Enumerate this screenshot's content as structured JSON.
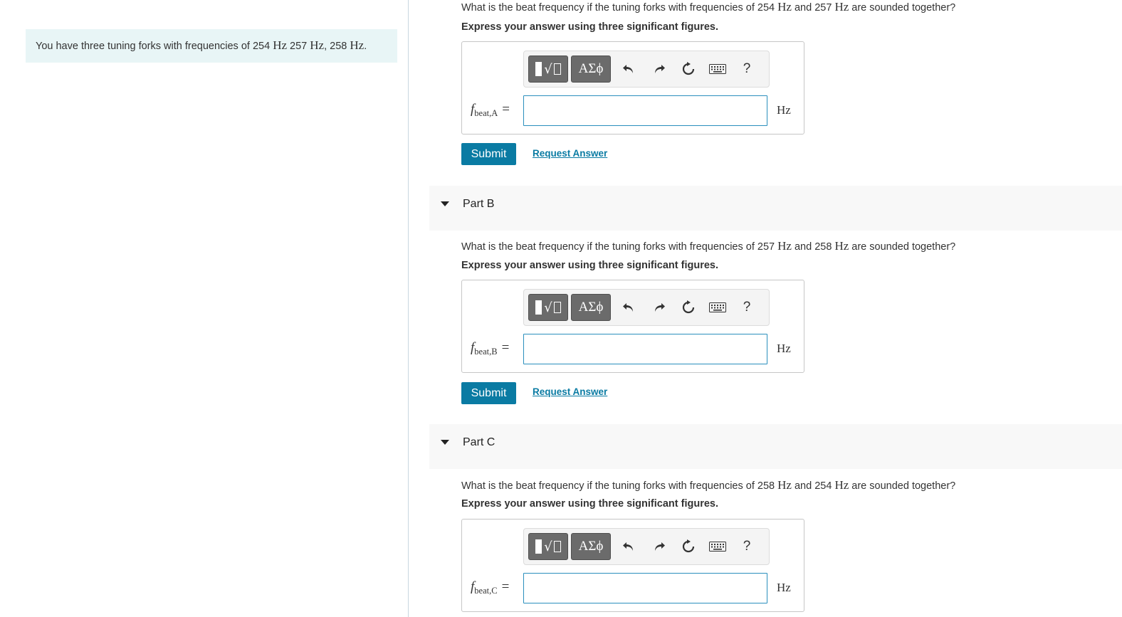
{
  "intro": {
    "text_prefix": "You have three tuning forks with frequencies of 254 ",
    "unit1": "Hz",
    "text_mid1": " 257 ",
    "unit2": "Hz",
    "text_mid2": ", 258 ",
    "unit3": "Hz",
    "text_end": "."
  },
  "toolbar": {
    "greek_label": "ΑΣϕ",
    "help_label": "?"
  },
  "parts": [
    {
      "title": "",
      "question_prefix": "What is the beat frequency if the tuning forks with frequencies of 254 ",
      "question_unit1": "Hz",
      "question_mid": " and 257 ",
      "question_unit2": "Hz",
      "question_suffix": " are sounded together?",
      "instruction": "Express your answer using three significant figures.",
      "var_main": "f",
      "var_sub": "beat,A",
      "equals": "=",
      "answer_value": "",
      "unit": "Hz",
      "submit_label": "Submit",
      "request_label": "Request Answer"
    },
    {
      "title": "Part B",
      "question_prefix": "What is the beat frequency if the tuning forks with frequencies of 257 ",
      "question_unit1": "Hz",
      "question_mid": " and 258 ",
      "question_unit2": "Hz",
      "question_suffix": " are sounded together?",
      "instruction": "Express your answer using three significant figures.",
      "var_main": "f",
      "var_sub": "beat,B",
      "equals": "=",
      "answer_value": "",
      "unit": "Hz",
      "submit_label": "Submit",
      "request_label": "Request Answer"
    },
    {
      "title": "Part C",
      "question_prefix": "What is the beat frequency if the tuning forks with frequencies of 258 ",
      "question_unit1": "Hz",
      "question_mid": " and 254 ",
      "question_unit2": "Hz",
      "question_suffix": " are sounded together?",
      "instruction": "Express your answer using three significant figures.",
      "var_main": "f",
      "var_sub": "beat,C",
      "equals": "=",
      "answer_value": "",
      "unit": "Hz"
    }
  ]
}
